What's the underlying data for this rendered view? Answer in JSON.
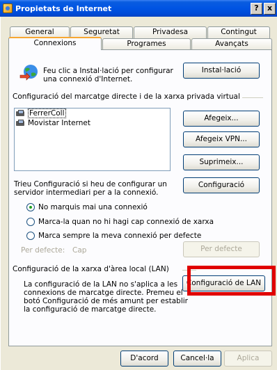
{
  "window": {
    "title": "Propietats de Internet",
    "help": "?",
    "close": "x"
  },
  "tabs_row1": [
    "General",
    "Seguretat",
    "Privadesa",
    "Contingut"
  ],
  "tabs_row2": [
    "Connexions",
    "Programes",
    "Avançats"
  ],
  "setup": {
    "text_line1": "Feu clic a Instal·lació per configurar",
    "text_line2": "una connexió d'Internet.",
    "button": "Instal·lació"
  },
  "dialup": {
    "group_title": "Configuració del marcatge directe i de la xarxa privada virtual",
    "items": [
      "FerrerColl",
      "Movistar Internet"
    ],
    "add": "Afegeix...",
    "add_vpn": "Afegeix VPN...",
    "remove": "Suprimeix...",
    "settings_text_line1": "Trieu Configuració si heu de configurar un",
    "settings_text_line2": "servidor intermediari per a la connexió.",
    "settings": "Configuració",
    "radio_never": "No marquis mai una connexió",
    "radio_no_network": "Marca-la quan no hi hagi cap connexió de xarxa",
    "radio_always": "Marca sempre la meva connexió per defecte",
    "default_label": "Per defecte:",
    "default_value": "Cap",
    "default_button": "Per defecte"
  },
  "lan": {
    "group_title": "Configuració de la xarxa d'àrea local (LAN)",
    "text_line1": "La configuració de la LAN no s'aplica a les",
    "text_line2": "connexions de marcatge directe. Premeu el",
    "text_line3": "botó Configuració de més amunt per establir",
    "text_line4": "la configuració de marcatge directe.",
    "button": "Configuració de LAN"
  },
  "footer": {
    "ok": "D'acord",
    "cancel": "Cancel·la",
    "apply": "Aplica"
  },
  "colors": {
    "highlight": "#e00000",
    "titlebar": "#0054e3"
  }
}
